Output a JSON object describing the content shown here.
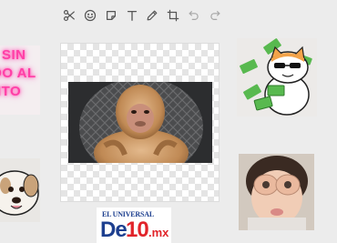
{
  "toolbar": {
    "tools": [
      {
        "name": "cut",
        "icon": "scissors-icon"
      },
      {
        "name": "emoji",
        "icon": "smiley-icon"
      },
      {
        "name": "sticker",
        "icon": "sticker-icon"
      },
      {
        "name": "text",
        "icon": "text-icon"
      },
      {
        "name": "draw",
        "icon": "pencil-icon"
      },
      {
        "name": "crop",
        "icon": "crop-icon"
      },
      {
        "name": "undo",
        "icon": "undo-icon",
        "enabled": false
      },
      {
        "name": "redo",
        "icon": "redo-icon",
        "enabled": false
      }
    ]
  },
  "stickers": {
    "neon_text": {
      "lines": [
        "SIN",
        "DO AL",
        "ITO"
      ],
      "color": "#ff3fa6"
    },
    "logo": {
      "top": "EL UNIVERSAL",
      "de": "De",
      "ten": "10",
      "domain": ".mx",
      "colors": {
        "blue": "#1d3f8f",
        "red": "#e1242a"
      }
    }
  },
  "colors": {
    "background": "#ececec",
    "icon": "#555555"
  }
}
